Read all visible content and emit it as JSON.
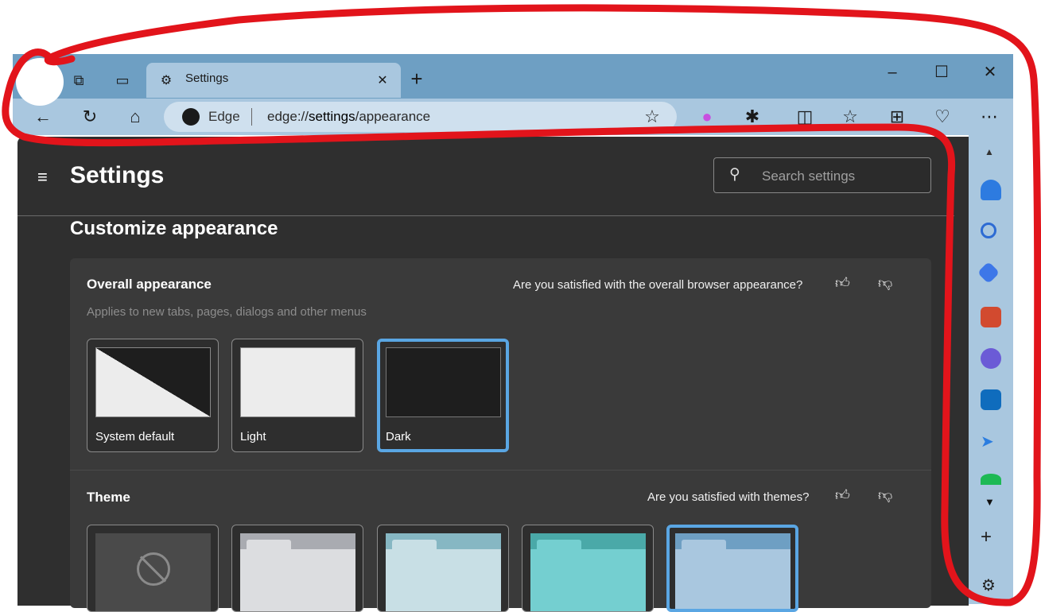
{
  "browser": {
    "tab": {
      "title": "Settings"
    },
    "address": {
      "brand": "Edge",
      "url_prefix": "edge://",
      "url_bold": "settings",
      "url_suffix": "/appearance"
    },
    "window_buttons": {
      "minimize": "–",
      "maximize": "☐",
      "close": "✕"
    }
  },
  "settings": {
    "title": "Settings",
    "search_placeholder": "Search settings",
    "section_title": "Customize appearance",
    "overall": {
      "title": "Overall appearance",
      "question": "Are you satisfied with the overall browser appearance?",
      "subtitle": "Applies to new tabs, pages, dialogs and other menus",
      "options": [
        {
          "label": "System default"
        },
        {
          "label": "Light"
        },
        {
          "label": "Dark"
        }
      ],
      "selected_index": 2
    },
    "theme": {
      "title": "Theme",
      "question": "Are you satisfied with themes?",
      "selected_index": 4
    }
  },
  "colors": {
    "accent": "#5aa6e3",
    "annotation": "#e2141b"
  }
}
